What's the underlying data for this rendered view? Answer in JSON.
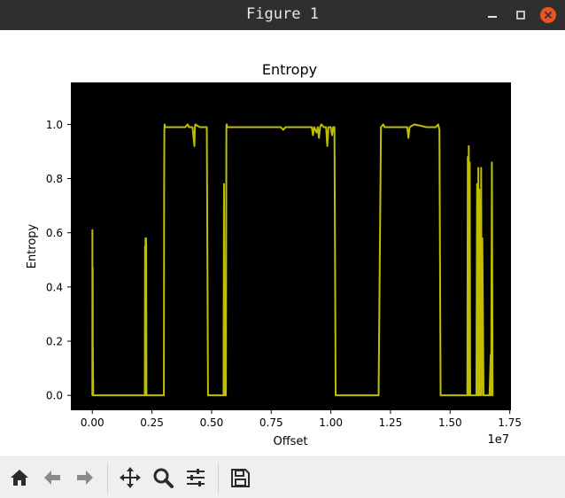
{
  "window": {
    "title": "Figure 1",
    "controls": {
      "minimize": "minimize",
      "maximize": "maximize",
      "close": "close"
    }
  },
  "toolbar": {
    "buttons": [
      "home-icon",
      "back-arrow-icon",
      "forward-arrow-icon",
      "pan-icon",
      "zoom-icon",
      "configure-subplots-icon",
      "save-icon"
    ]
  },
  "colors": {
    "titlebar": "#2f2f2f",
    "plot_background": "#000000",
    "line": "#bfbf00",
    "close_button": "#e95420"
  },
  "chart_data": {
    "type": "line",
    "title": "Entropy",
    "xlabel": "Offset",
    "ylabel": "Entropy",
    "x_offset_text": "1e7",
    "xlim": [
      -0.09,
      1.755
    ],
    "ylim": [
      -0.055,
      1.155
    ],
    "xticks": [
      0.0,
      0.25,
      0.5,
      0.75,
      1.0,
      1.25,
      1.5,
      1.75
    ],
    "xtick_labels": [
      "0.00",
      "0.25",
      "0.50",
      "0.75",
      "1.00",
      "1.25",
      "1.50",
      "1.75"
    ],
    "yticks": [
      0.0,
      0.2,
      0.4,
      0.6,
      0.8,
      1.0
    ],
    "ytick_labels": [
      "0.0",
      "0.2",
      "0.4",
      "0.6",
      "0.8",
      "1.0"
    ],
    "grid": false,
    "series": [
      {
        "x": [
          0.0,
          0.003,
          0.006,
          0.009,
          0.012,
          0.015,
          0.018,
          0.021,
          0.024,
          0.027,
          0.03,
          0.033,
          0.036,
          0.039,
          0.042,
          0.045,
          0.05,
          0.1,
          0.2,
          0.5,
          1.0,
          1.5,
          2.0,
          2.18,
          2.2,
          2.21,
          2.22,
          2.23,
          2.24,
          2.25,
          2.26,
          2.27,
          2.28,
          2.3,
          2.5,
          2.8,
          3.0,
          3.01,
          3.02,
          3.03,
          3.05,
          3.1,
          3.5,
          3.9,
          4.0,
          4.05,
          4.1,
          4.2,
          4.28,
          4.3,
          4.32,
          4.5,
          4.8,
          4.85,
          4.9,
          5.0,
          5.2,
          5.5,
          5.52,
          5.55,
          5.6,
          5.62,
          5.63,
          5.65,
          6.0,
          6.5,
          7.0,
          7.5,
          7.9,
          8.0,
          8.1,
          8.5,
          9.0,
          9.2,
          9.25,
          9.3,
          9.4,
          9.45,
          9.5,
          9.55,
          9.6,
          9.7,
          9.8,
          9.85,
          9.9,
          10.0,
          10.05,
          10.1,
          10.15,
          10.2,
          10.3,
          10.5,
          11.0,
          11.5,
          12.0,
          12.1,
          12.2,
          12.25,
          12.3,
          12.5,
          12.8,
          13.0,
          13.2,
          13.25,
          13.3,
          13.5,
          14.0,
          14.3,
          14.4,
          14.5,
          14.55,
          14.6,
          14.7,
          15.0,
          15.5,
          15.7,
          15.72,
          15.74,
          15.76,
          15.78,
          15.8,
          15.82,
          15.84,
          15.9,
          16.0,
          16.05,
          16.1,
          16.13,
          16.16,
          16.18,
          16.2,
          16.22,
          16.24,
          16.26,
          16.28,
          16.3,
          16.32,
          16.35,
          16.4,
          16.45,
          16.5,
          16.55,
          16.6,
          16.65,
          16.7,
          16.72,
          16.75,
          16.78,
          16.8
        ],
        "y": [
          0.0,
          0.61,
          0.15,
          0.0,
          0.35,
          0.02,
          0.47,
          0.0,
          0.18,
          0.0,
          0.12,
          0.0,
          0.06,
          0.0,
          0.0,
          0.0,
          0.0,
          0.0,
          0.0,
          0.0,
          0.0,
          0.0,
          0.0,
          0.0,
          0.0,
          0.55,
          0.0,
          0.58,
          0.25,
          0.58,
          0.55,
          0.0,
          0.0,
          0.0,
          0.0,
          0.0,
          0.0,
          0.76,
          0.98,
          1.0,
          0.99,
          0.99,
          0.99,
          0.99,
          1.0,
          0.99,
          0.99,
          0.99,
          0.92,
          0.99,
          1.0,
          0.99,
          0.99,
          0.0,
          0.0,
          0.0,
          0.0,
          0.0,
          0.78,
          0.0,
          0.0,
          0.99,
          1.0,
          0.99,
          0.99,
          0.99,
          0.99,
          0.99,
          0.99,
          0.98,
          0.99,
          0.99,
          0.99,
          0.99,
          0.96,
          0.99,
          0.97,
          0.99,
          0.95,
          0.99,
          1.0,
          0.99,
          0.99,
          0.92,
          0.99,
          0.99,
          0.96,
          0.99,
          0.99,
          0.0,
          0.0,
          0.0,
          0.0,
          0.0,
          0.0,
          0.99,
          1.0,
          0.99,
          0.99,
          0.99,
          0.99,
          0.99,
          0.99,
          0.95,
          0.99,
          1.0,
          0.99,
          0.99,
          0.99,
          1.0,
          0.98,
          0.0,
          0.0,
          0.0,
          0.0,
          0.0,
          0.0,
          0.88,
          0.0,
          0.92,
          0.0,
          0.86,
          0.0,
          0.0,
          0.0,
          0.0,
          0.0,
          0.78,
          0.0,
          0.84,
          0.0,
          0.76,
          0.0,
          0.72,
          0.0,
          0.84,
          0.0,
          0.58,
          0.0,
          0.0,
          0.0,
          0.0,
          0.0,
          0.0,
          0.15,
          0.0,
          0.86,
          0.0,
          0.0
        ],
        "x_scale_note": "x values are in units of 1e6 offset; divide by 10 for axis units (1e7)"
      }
    ]
  }
}
